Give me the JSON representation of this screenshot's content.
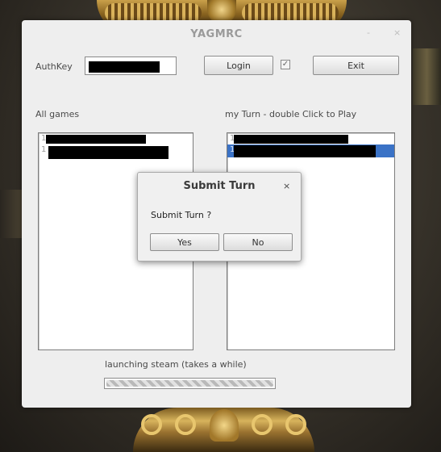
{
  "window": {
    "title": "YAGMRC",
    "minimize": "-",
    "close": "×"
  },
  "auth": {
    "label": "AuthKey",
    "value": "",
    "login": "Login",
    "exit": "Exit",
    "checkbox_mark": "✓"
  },
  "lists": {
    "all_label": "All games",
    "turn_label": "my Turn - double Click to Play",
    "all_items": [
      "1",
      "1"
    ],
    "turn_items": [
      "1",
      "1"
    ]
  },
  "status": {
    "text": "launching steam (takes a while)",
    "progress": 1.0
  },
  "dialog": {
    "title": "Submit Turn",
    "close": "×",
    "message": "Submit Turn ?",
    "yes": "Yes",
    "no": "No"
  },
  "colors": {
    "selection": "#3a72c6",
    "window_bg": "#eeeeee"
  }
}
